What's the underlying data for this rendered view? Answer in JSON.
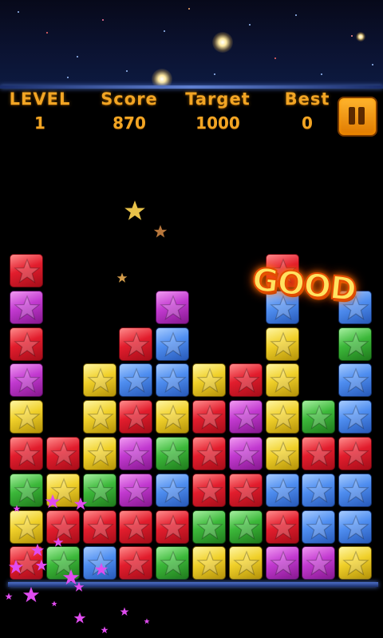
{
  "hud": {
    "level_label": "LEVEL",
    "level_value": "1",
    "score_label": "Score",
    "score_value": "870",
    "target_label": "Target",
    "target_value": "1000",
    "best_label": "Best",
    "best_value": "0"
  },
  "feedback_text": "GOOD",
  "pause_icon": "pause-icon",
  "colors": {
    "red": "#e21d2d",
    "purple": "#c23ad0",
    "blue": "#4f8ef0",
    "yellow": "#f0d02a",
    "green": "#3cb83a",
    "hud_text": "#f2a524"
  },
  "board": {
    "columns": 10,
    "rows": 9,
    "grid": [
      [
        "red",
        null,
        null,
        null,
        null,
        null,
        null,
        "red",
        null,
        null
      ],
      [
        "purple",
        null,
        null,
        null,
        "purple",
        null,
        null,
        "blue",
        null,
        "blue"
      ],
      [
        "red",
        null,
        null,
        "red",
        "blue",
        null,
        null,
        "yellow",
        null,
        "green"
      ],
      [
        "purple",
        null,
        "yellow",
        "blue",
        "blue",
        "yellow",
        "red",
        "yellow",
        null,
        "blue"
      ],
      [
        "yellow",
        null,
        "yellow",
        "red",
        "yellow",
        "red",
        "purple",
        "yellow",
        "green",
        "blue"
      ],
      [
        "red",
        "red",
        "yellow",
        "purple",
        "green",
        "red",
        "purple",
        "yellow",
        "red",
        "red"
      ],
      [
        "green",
        "yellow",
        "green",
        "purple",
        "blue",
        "red",
        "red",
        "blue",
        "blue",
        "blue"
      ],
      [
        "yellow",
        "red",
        "red",
        "red",
        "red",
        "green",
        "green",
        "red",
        "blue",
        "blue"
      ],
      [
        "red",
        "green",
        "blue",
        "red",
        "green",
        "yellow",
        "yellow",
        "purple",
        "purple",
        "yellow"
      ]
    ]
  }
}
